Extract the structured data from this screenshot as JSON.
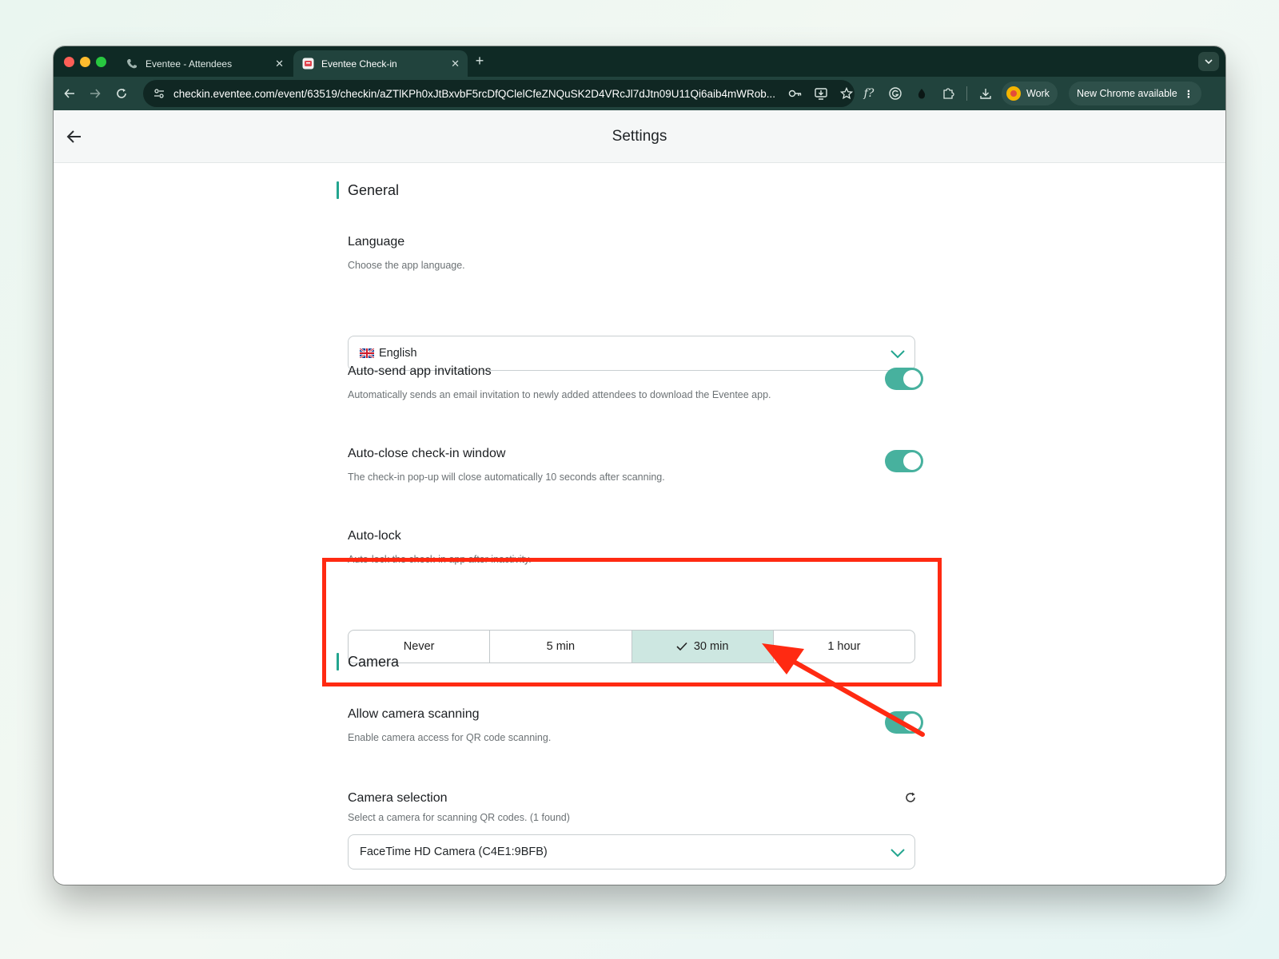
{
  "browser": {
    "tabs": [
      {
        "title": "Eventee - Attendees",
        "active": false,
        "icon": "phone-icon"
      },
      {
        "title": "Eventee Check-in",
        "active": true,
        "icon": "eventee-app-icon"
      }
    ],
    "url": "checkin.eventee.com/event/63519/checkin/aZTlKPh0xJtBxvbF5rcDfQClelCfeZNQuSK2D4VRcJl7dJtn09U11Qi6aib4mWRob...",
    "profile_label": "Work",
    "update_label": "New Chrome available"
  },
  "header": {
    "title": "Settings"
  },
  "general": {
    "section_title": "General",
    "language": {
      "label": "Language",
      "description": "Choose the app language.",
      "value": "English",
      "flag": "uk-flag-icon"
    },
    "auto_send": {
      "label": "Auto-send app invitations",
      "description": "Automatically sends an email invitation to newly added attendees to download the Eventee app.",
      "enabled": true
    },
    "auto_close": {
      "label": "Auto-close check-in window",
      "description": "The check-in pop-up will close automatically 10 seconds after scanning.",
      "enabled": true
    },
    "auto_lock": {
      "label": "Auto-lock",
      "description": "Auto-lock the check-in app after inactivity.",
      "options": [
        "Never",
        "5 min",
        "30 min",
        "1 hour"
      ],
      "selected": "30 min"
    }
  },
  "camera": {
    "section_title": "Camera",
    "allow_scanning": {
      "label": "Allow camera scanning",
      "description": "Enable camera access for QR code scanning.",
      "enabled": true
    },
    "selection": {
      "label": "Camera selection",
      "description": "Select a camera for scanning QR codes. (1 found)",
      "value": "FaceTime HD Camera (C4E1:9BFB)"
    }
  },
  "colors": {
    "accent": "#23a58f",
    "toggle_on": "#47b19e",
    "selected_segment": "#cde7e1",
    "annotation": "#ff2a12",
    "browser_frame": "#0f2a25"
  }
}
